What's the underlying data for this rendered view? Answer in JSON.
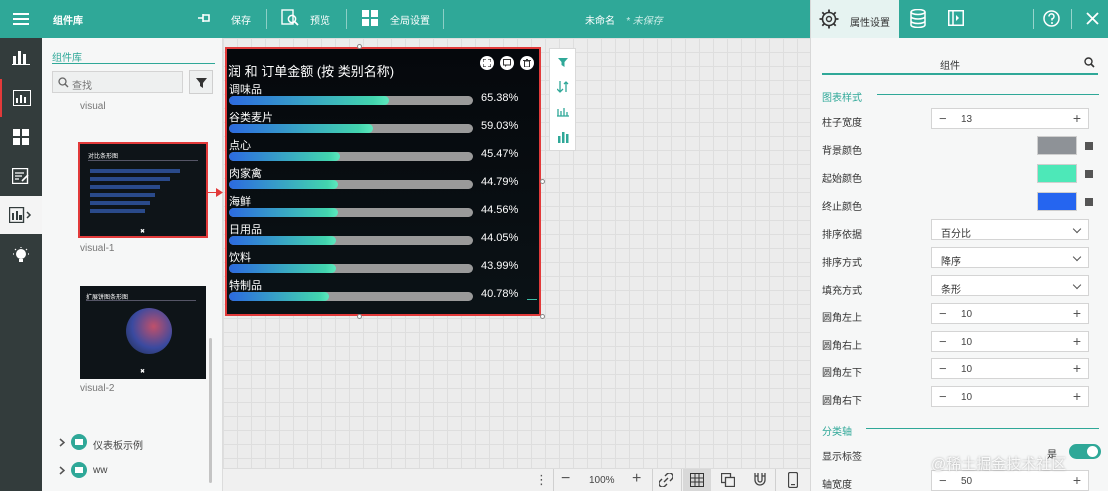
{
  "header": {
    "library_title": "组件库",
    "save_label": "保存",
    "preview_label": "预览",
    "global_settings_label": "全局设置",
    "doc_name": "未命名",
    "doc_status": "* 未保存"
  },
  "right_tabs": {
    "properties_label": "属性设置"
  },
  "library": {
    "heading": "组件库",
    "search_placeholder": "查找",
    "items": [
      {
        "label": "visual",
        "thumb_title": ""
      },
      {
        "label": "visual-1",
        "thumb_title": "对比条形图"
      },
      {
        "label": "visual-2",
        "thumb_title": "扩展饼图条形图"
      }
    ],
    "folders": [
      {
        "label": "仪表板示例"
      },
      {
        "label": "ww"
      }
    ]
  },
  "chart_data": {
    "type": "bar",
    "title": "润 和 订单金额 (按 类别名称)",
    "categories": [
      "调味品",
      "谷类麦片",
      "点心",
      "肉家禽",
      "海鲜",
      "日用品",
      "饮料",
      "特制品"
    ],
    "values": [
      65.38,
      59.03,
      45.47,
      44.79,
      44.56,
      44.05,
      43.99,
      40.78
    ],
    "value_labels": [
      "65.38%",
      "59.03%",
      "45.47%",
      "44.79%",
      "44.56%",
      "44.05%",
      "43.99%",
      "40.78%"
    ],
    "xlim": [
      0,
      100
    ],
    "colors": {
      "start": "#4de8b8",
      "end": "#2c6ae0",
      "background": "#9a9a9a"
    }
  },
  "bottom_bar": {
    "zoom": "100%"
  },
  "properties": {
    "subtab": "组件",
    "chart_style_section": "图表样式",
    "bar_width": {
      "label": "柱子宽度",
      "value": "13"
    },
    "bg_color": {
      "label": "背景颜色",
      "color": "#8e9297"
    },
    "start_color": {
      "label": "起始颜色",
      "color": "#4de8b8"
    },
    "end_color": {
      "label": "终止颜色",
      "color": "#2565f0"
    },
    "sort_by": {
      "label": "排序依据",
      "value": "百分比"
    },
    "sort_order": {
      "label": "排序方式",
      "value": "降序"
    },
    "fill_mode": {
      "label": "填充方式",
      "value": "条形"
    },
    "radius_tl": {
      "label": "圆角左上",
      "value": "10"
    },
    "radius_tr": {
      "label": "圆角右上",
      "value": "10"
    },
    "radius_bl": {
      "label": "圆角左下",
      "value": "10"
    },
    "radius_br": {
      "label": "圆角右下",
      "value": "10"
    },
    "category_axis_section": "分类轴",
    "show_labels": {
      "label": "显示标签",
      "state": "是"
    },
    "axis_width": {
      "label": "轴宽度",
      "value": "50"
    }
  },
  "watermark": "@稀土掘金技术社区"
}
